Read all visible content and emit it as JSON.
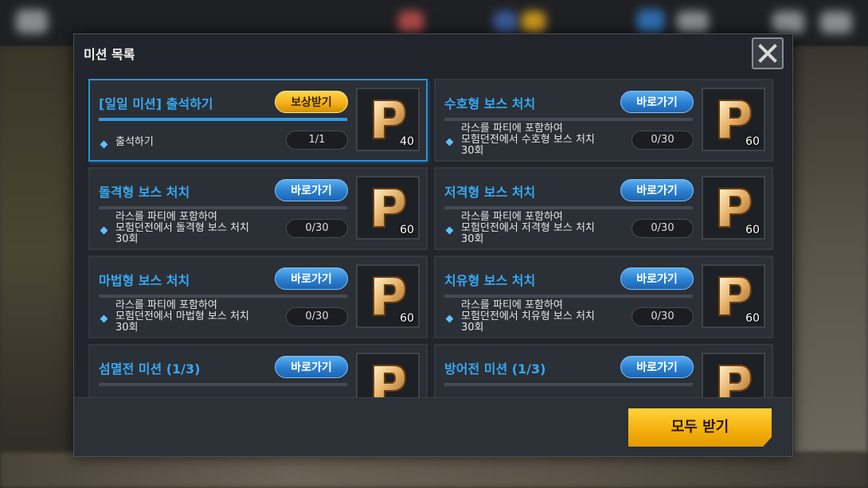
{
  "modal": {
    "title": "미션 목록",
    "claim_all_label": "모두 받기"
  },
  "missions": [
    {
      "title": "[일일 미션] 출석하기",
      "button": "보상받기",
      "desc_lines": [
        "출석하기"
      ],
      "progress": "1/1",
      "reward_qty": "40",
      "progress_fraction": 1.0
    },
    {
      "title": "수호형 보스 처치",
      "button": "바로가기",
      "desc_lines": [
        "라스를 파티에 포함하여",
        "모험던전에서 수호형 보스 처치",
        "30회"
      ],
      "progress": "0/30",
      "reward_qty": "60",
      "progress_fraction": 0
    },
    {
      "title": "돌격형 보스 처치",
      "button": "바로가기",
      "desc_lines": [
        "라스를 파티에 포함하여",
        "모험던전에서 돌격형 보스 처치",
        "30회"
      ],
      "progress": "0/30",
      "reward_qty": "60",
      "progress_fraction": 0
    },
    {
      "title": "저격형 보스 처치",
      "button": "바로가기",
      "desc_lines": [
        "라스를 파티에 포함하여",
        "모험던전에서 저격형 보스 처치",
        "30회"
      ],
      "progress": "0/30",
      "reward_qty": "60",
      "progress_fraction": 0
    },
    {
      "title": "마법형 보스 처치",
      "button": "바로가기",
      "desc_lines": [
        "라스를 파티에 포함하여",
        "모험던전에서 마법형 보스 처치",
        "30회"
      ],
      "progress": "0/30",
      "reward_qty": "60",
      "progress_fraction": 0
    },
    {
      "title": "치유형 보스 처치",
      "button": "바로가기",
      "desc_lines": [
        "라스를 파티에 포함하여",
        "모험던전에서 치유형 보스 처치",
        "30회"
      ],
      "progress": "0/30",
      "reward_qty": "60",
      "progress_fraction": 0
    },
    {
      "title": "섬멸전 미션 (1/3)",
      "button": "바로가기"
    },
    {
      "title": "방어전 미션 (1/3)",
      "button": "바로가기"
    }
  ],
  "colors": {
    "accent_blue": "#36a9f2",
    "reward_gold": "#f4b10e",
    "panel_bg": "#22252b"
  },
  "icons": {
    "close": "close-icon",
    "reward": "p-point-icon",
    "bullet": "diamond-bullet-icon"
  }
}
